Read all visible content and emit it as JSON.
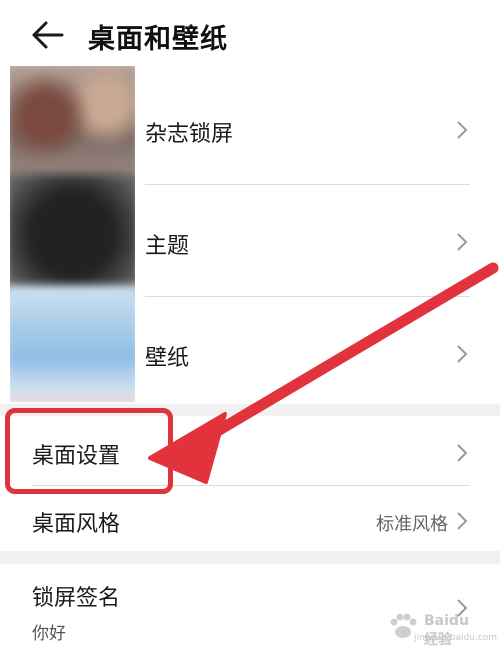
{
  "header": {
    "title": "桌面和壁纸",
    "back_icon": "back-arrow-icon"
  },
  "main_items": [
    {
      "label": "杂志锁屏"
    },
    {
      "label": "主题"
    },
    {
      "label": "壁纸"
    }
  ],
  "desktop_section": {
    "desktop_settings": {
      "label": "桌面设置"
    },
    "desktop_style": {
      "label": "桌面风格",
      "value": "标准风格"
    }
  },
  "lock_signature": {
    "label": "锁屏签名",
    "value": "你好"
  },
  "annotation": {
    "color": "#e2323c",
    "highlighted_item": "桌面设置"
  },
  "watermark": {
    "brand": "Baidu 经验",
    "url": "jingyan.baidu.com"
  }
}
